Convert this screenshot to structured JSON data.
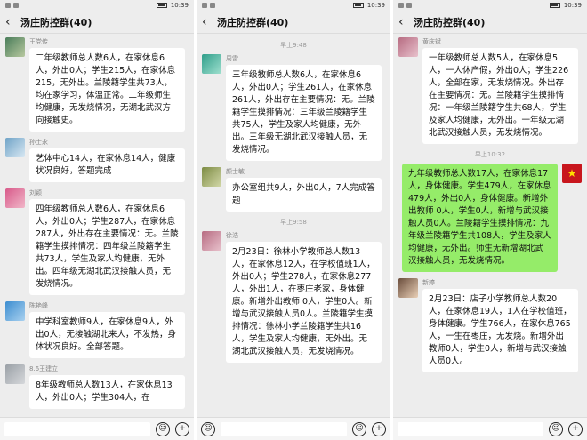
{
  "status": {
    "time": "10:39"
  },
  "panels": [
    {
      "title": "汤庄防控群(40)",
      "back_icon": "chevron-left-icon",
      "messages": [
        {
          "avatar": "av-green",
          "name": "王党传",
          "text": "二年级教师总人数6人，在家休息6人，外出0人；学生215人，在家休息215，无外出。兰陵籍学生共73人，均在家学习，体温正常。二年级师生均健康，无发烧情况，无湖北武汉方向接触史。"
        },
        {
          "avatar": "av-blue",
          "name": "孙士永",
          "text": "艺体中心14人，在家休息14人，健康状况良好，答题完成"
        },
        {
          "avatar": "av-pink",
          "name": "刘颖",
          "text": "四年级教师总人数6人，在家休息6人，外出0人；学生287人，在家休息287人，外出存在主要情况：无。兰陵籍学生摸排情况：四年级兰陵籍学生共73人，学生及家人均健康，无外出。四年级无湖北武汉接触人员，无发烧情况。"
        },
        {
          "avatar": "av-sky",
          "name": "陈艳峰",
          "text": "中学科室教师9人，在家休息9人，外出0人，无接触湖北来人，不发热，身体状况良好。全部答题。"
        },
        {
          "avatar": "av-grey",
          "name": "8.6王建立",
          "text": "8年级教师总人数13人，在家休息13人，外出0人；学生304人，在"
        }
      ]
    },
    {
      "title": "汤庄防控群(40)",
      "back_icon": "chevron-left-icon",
      "time1": "早上9:48",
      "time2": "早上9:58",
      "messages": [
        {
          "avatar": "av-teal",
          "name": "周雷",
          "text": "三年级教师总人数6人，在家休息6人，外出0人；学生261人，在家休息261人，外出存在主要情况：无。兰陵籍学生摸排情况：三年级兰陵籍学生共75人，学生及家人均健康，无外出。三年级无湖北武汉接触人员，无发烧情况。"
        },
        {
          "avatar": "av-olive",
          "name": "颜士敏",
          "text": "办公室组共9人，外出0人，7人完成答题"
        },
        {
          "avatar": "av-rose",
          "name": "徐浩",
          "text": "2月23日：徐林小学教师总人数13人，在家休息12人，在学校值班1人，外出0人；学生278人，在家休息277人，外出1人，在枣庄老家，身体健康。新增外出教师 0人，学生0人。新增与武汉接触人员0人。兰陵籍学生摸排情况：徐林小学兰陵籍学生共16人，学生及家人均健康，无外出。无湖北武汉接触人员，无发烧情况。"
        }
      ]
    },
    {
      "title": "汤庄防控群(40)",
      "back_icon": "chevron-left-icon",
      "time1": "早上10:32",
      "messages": [
        {
          "avatar": "av-rose",
          "name": "黄庆斌",
          "text": "一年级教师总人数5人，在家休息5人，一人休产假，外出0人；学生226人，全部在家，无发烧情况。外出存在主要情况：无。兰陵籍学生摸排情况：一年级兰陵籍学生共68人，学生及家人均健康，无外出。一年级无湖北武汉接触人员，无发烧情况。"
        },
        {
          "avatar": "av-flag",
          "name": "",
          "text": "九年级教师总人数17人，在家休息17人，身体健康。学生479人，在家休息479人，外出0人，身体健康。新增外出教师 0人，学生0人，新增与武汉接触人员0人。兰陵籍学生摸排情况：九年级兰陵籍学生共108人，学生及家人均健康，无外出。师生无新增湖北武汉接触人员，无发烧情况。",
          "right": true
        },
        {
          "avatar": "av-girl",
          "name": "新婷",
          "text": "2月23日：店子小学教师总人数20人，在家休息19人，1人在学校值班，身体健康。学生766人，在家休息765人，一生在枣庄，无发烧。新增外出教师0人，学生0人，新增与武汉接触人员0人。"
        }
      ]
    }
  ]
}
